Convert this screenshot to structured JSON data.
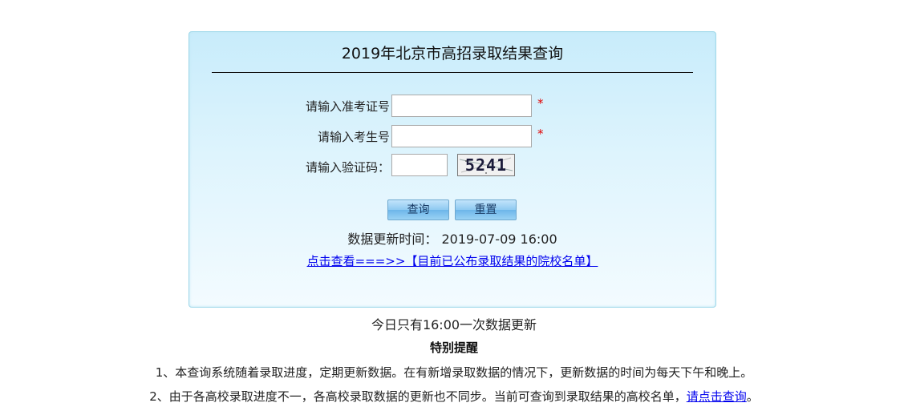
{
  "panel": {
    "title": "2019年北京市高招录取结果查询",
    "form": {
      "exam_ticket_label": "请输入准考证号",
      "exam_ticket_value": "",
      "student_no_label": "请输入考生号",
      "student_no_value": "",
      "captcha_label": "请输入验证码：",
      "captcha_value": "",
      "captcha_image_text": "5241",
      "required_mark": "*"
    },
    "buttons": {
      "query_label": "查询",
      "reset_label": "重置"
    },
    "update": {
      "label": "数据更新时间：",
      "time": "2019-07-09 16:00"
    },
    "schools_link": "点击查看===>>【目前已公布录取结果的院校名单】"
  },
  "daily_note": "今日只有16:00一次数据更新",
  "notice": {
    "title": "特别提醒",
    "item1": "1、本查询系统随着录取进度，定期更新数据。在有新增录取数据的情况下，更新数据的时间为每天下午和晚上。",
    "item2_prefix": "2、由于各高校录取进度不一，各高校录取数据的更新也不同步。当前可查询到录取结果的高校名单，",
    "item2_link": "请点击查询",
    "item2_suffix": "。"
  },
  "colors": {
    "required": "#e10000",
    "link": "#0000ee",
    "panel_border": "#9fd8ea"
  }
}
